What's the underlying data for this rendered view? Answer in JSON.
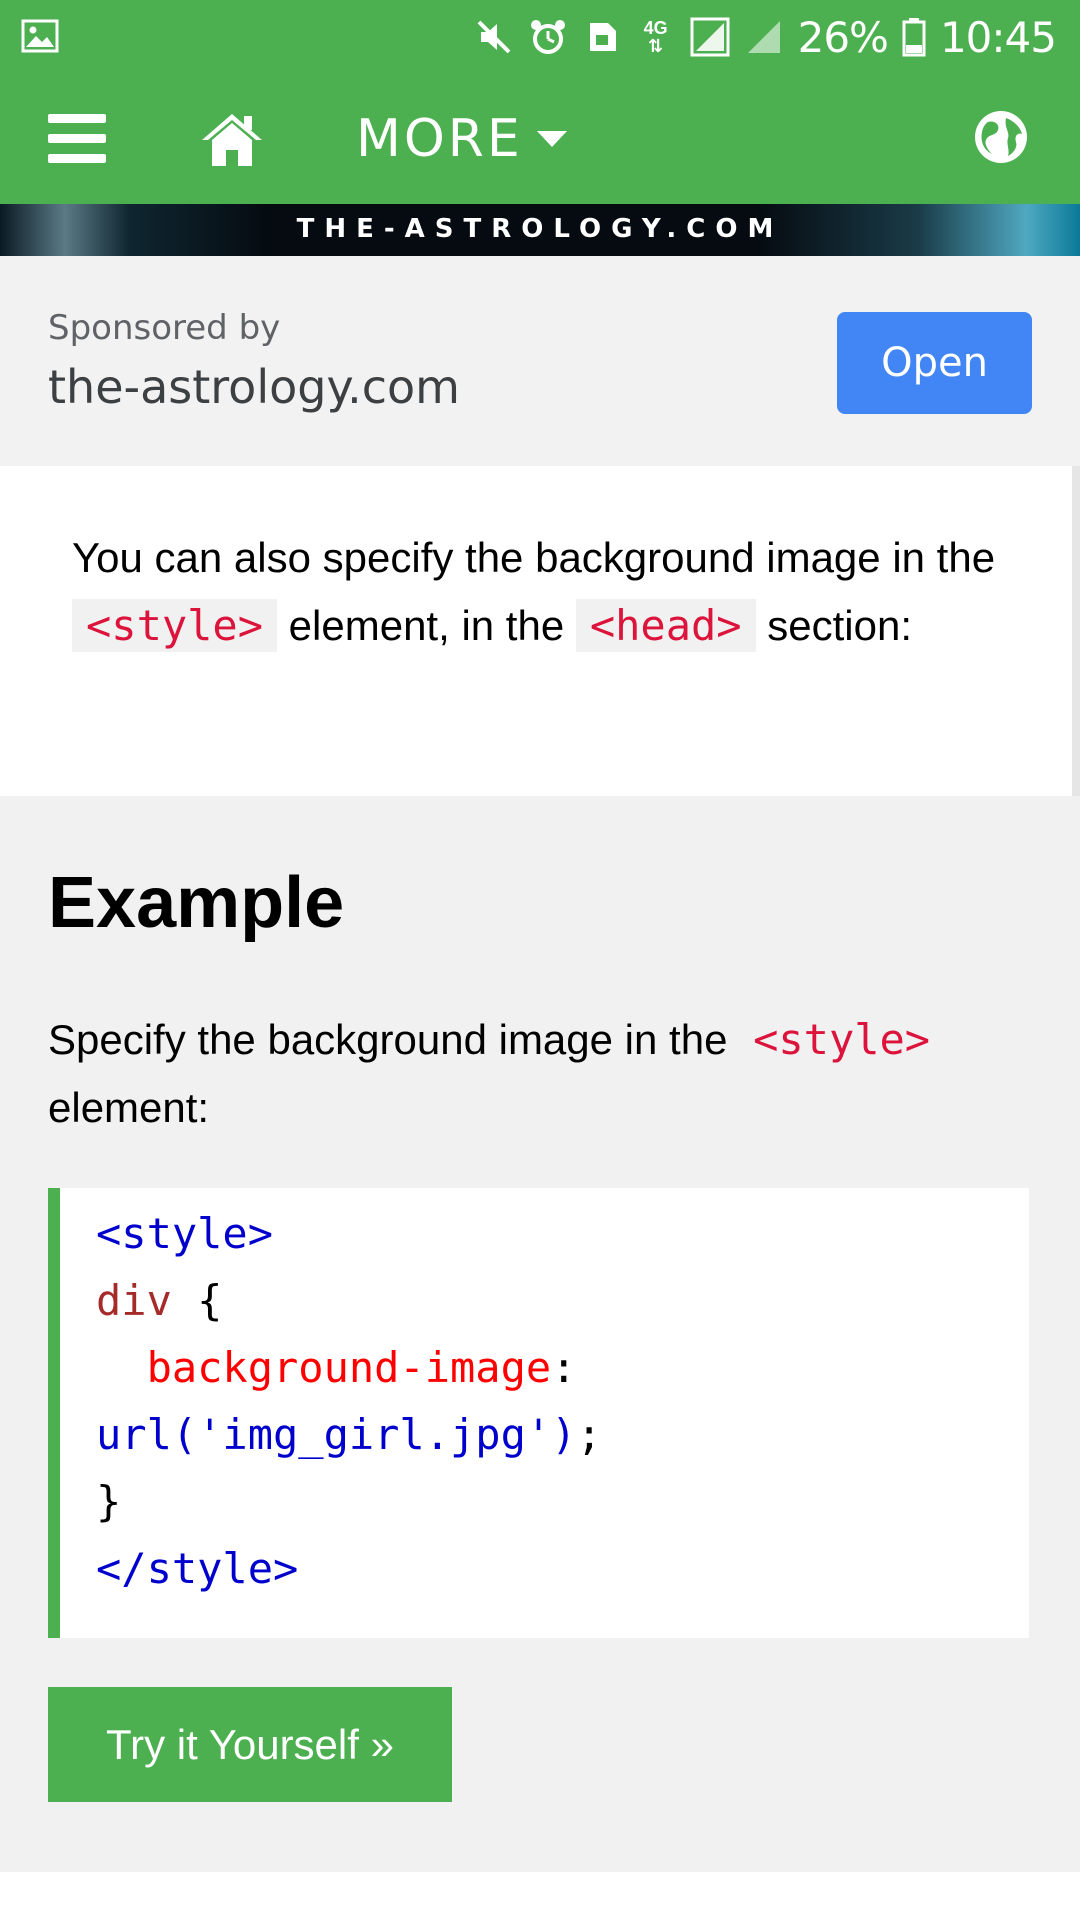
{
  "status_bar": {
    "network": "4G",
    "battery": "26%",
    "time": "10:45"
  },
  "nav": {
    "more_label": "MORE"
  },
  "banner": {
    "text": "THE-ASTROLOGY.COM"
  },
  "sponsor": {
    "sponsored_by": "Sponsored by",
    "domain": "the-astrology.com",
    "open_label": "Open"
  },
  "intro": {
    "part1": "You can also specify the background image in the ",
    "code1": "<style>",
    "part2": " element, in the ",
    "code2": "<head>",
    "part3": " section:"
  },
  "example": {
    "title": "Example",
    "desc_part1": "Specify the background image in the ",
    "desc_code": "<style>",
    "desc_part2": " element:",
    "code": {
      "l1": "<style>",
      "l2_sel": "div",
      "l2_brace": " {",
      "l3_prop": "  background-image",
      "l3_colon": ":",
      "l4_val": "url('img_girl.jpg')",
      "l4_semi": ";",
      "l5": "}",
      "l6": "</style>"
    },
    "try_label": "Try it Yourself »"
  },
  "colors": {
    "brand_green": "#4caf50",
    "open_blue": "#4285f4",
    "code_red": "#dc143c"
  }
}
